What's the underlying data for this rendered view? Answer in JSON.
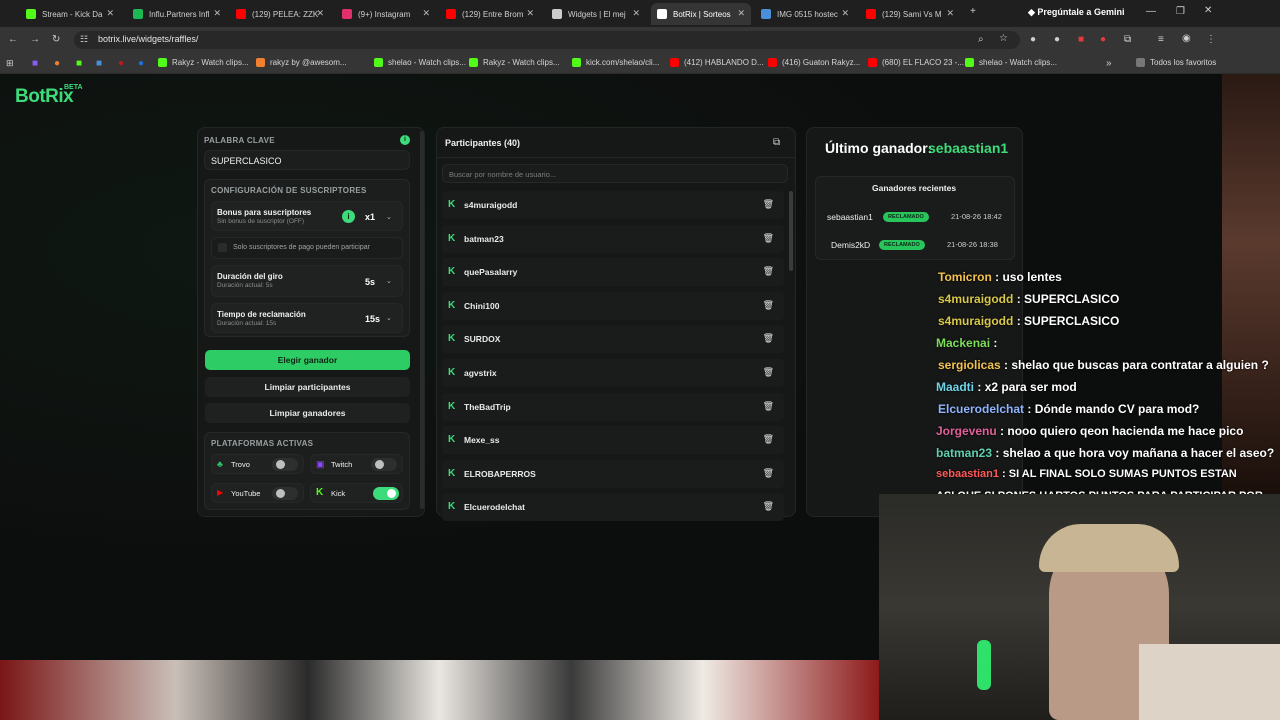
{
  "browser": {
    "tabs": [
      {
        "label": "Stream - Kick Da",
        "color": "#53fc18"
      },
      {
        "label": "Influ.Partners Infl",
        "color": "#1db954"
      },
      {
        "label": "(129) PELEA: ZZK",
        "color": "#ff0000"
      },
      {
        "label": "(9+) Instagram",
        "color": "#e1306c"
      },
      {
        "label": "(129) Entre Brom",
        "color": "#ff0000"
      },
      {
        "label": "Widgets | El mej",
        "color": "#cccccc"
      },
      {
        "label": "BotRix | Sorteos",
        "color": "#ffffff"
      },
      {
        "label": "IMG 0515 hostec",
        "color": "#4a90d9"
      },
      {
        "label": "(129) Sami Vs M",
        "color": "#ff0000"
      }
    ],
    "gemini_label": "Pregúntale a Gemini",
    "url": "botrix.live/widgets/raffles/",
    "bookmarks": [
      {
        "label": "Rakyz - Watch clips...",
        "color": "#53fc18"
      },
      {
        "label": "rakyz by @awesom...",
        "color": "#f08030"
      },
      {
        "label": "shelao - Watch clips...",
        "color": "#53fc18"
      },
      {
        "label": "Rakyz - Watch clips...",
        "color": "#53fc18"
      },
      {
        "label": "kick.com/shelao/cli...",
        "color": "#53fc18"
      },
      {
        "label": "(412) HABLANDO D...",
        "color": "#ff0000"
      },
      {
        "label": "(416) Guaton Rakyz...",
        "color": "#ff0000"
      },
      {
        "label": "(680) EL FLACO 23 -...",
        "color": "#ff0000"
      },
      {
        "label": "shelao - Watch clips...",
        "color": "#53fc18"
      }
    ],
    "all_favorites": "Todos los favoritos"
  },
  "app": {
    "logo": "BotRix",
    "beta": "BETA",
    "accent": "#3ddc7a"
  },
  "settings": {
    "keyword_label": "PALABRA CLAVE",
    "keyword_value": "SUPERCLASICO",
    "subs_config_label": "CONFIGURACIÓN DE SUSCRIPTORES",
    "bonus_title": "Bonus para suscriptores",
    "bonus_sub": "Sin bonus de suscriptor (OFF)",
    "bonus_value": "x1",
    "paid_only": "Solo suscriptores de pago pueden participar",
    "spin_title": "Duración del giro",
    "spin_sub": "Duración actual: 5s",
    "spin_value": "5s",
    "claim_title": "Tiempo de reclamación",
    "claim_sub": "Duración actual: 15s",
    "claim_value": "15s",
    "choose_winner": "Elegir ganador",
    "clear_participants": "Limpiar participantes",
    "clear_winners": "Limpiar ganadores",
    "platforms_label": "PLATAFORMAS ACTIVAS",
    "platforms": [
      {
        "name": "Trovo",
        "on": false
      },
      {
        "name": "Twitch",
        "on": false
      },
      {
        "name": "YouTube",
        "on": false
      },
      {
        "name": "Kick",
        "on": true
      }
    ]
  },
  "participants": {
    "title": "Participantes (40)",
    "search_placeholder": "Buscar por nombre de usuario...",
    "list": [
      "s4muraigodd",
      "batman23",
      "quePasalarry",
      "Chini100",
      "SURDOX",
      "agvstrix",
      "TheBadTrip",
      "Mexe_ss",
      "ELROBAPERROS",
      "Elcuerodelchat"
    ]
  },
  "winners": {
    "last_label": "Último ganador:",
    "last_name": "sebaastian1",
    "recent_label": "Ganadores recientes",
    "rows": [
      {
        "name": "sebaastian1",
        "badge": "RECLAMADO",
        "date": "21-08-26 18:42"
      },
      {
        "name": "Demis2kD",
        "badge": "RECLAMADO",
        "date": "21-08-26 18:38"
      }
    ]
  },
  "chat": [
    {
      "user": "Tomicron",
      "color": "#f2c14e",
      "msg": ": uso lentes"
    },
    {
      "user": "s4muraigodd",
      "color": "#d8c84a",
      "msg": ": SUPERCLASICO"
    },
    {
      "user": "s4muraigodd",
      "color": "#d8c84a",
      "msg": ": SUPERCLASICO"
    },
    {
      "user": "Mackenai",
      "color": "#7ddc5a",
      "msg": ":"
    },
    {
      "user": "sergiolicas",
      "color": "#f2c14e",
      "msg": ": shelao que buscas para contratar a alguien ?"
    },
    {
      "user": "Maadti",
      "color": "#6fd3e8",
      "msg": ": x2 para ser mod"
    },
    {
      "user": "Elcuerodelchat",
      "color": "#8fb4ff",
      "msg": ": Dónde mando CV para mod?"
    },
    {
      "user": "Jorgevenu",
      "color": "#e0609a",
      "msg": ": nooo quiero qeon hacienda me hace pico"
    },
    {
      "user": "batman23",
      "color": "#5fd0b0",
      "msg": ": shelao a que hora voy mañana a hacer el aseo?"
    },
    {
      "user": "sebaastian1",
      "color": "#ff5a5a",
      "msg": ": SI AL FINAL SOLO SUMAS PUNTOS ESTAN"
    },
    {
      "user": "",
      "color": "#ffffff",
      "msg": "ASI QUE SI PONES HARTOS PUNTOS PARA PARTICIPAR POR"
    }
  ]
}
